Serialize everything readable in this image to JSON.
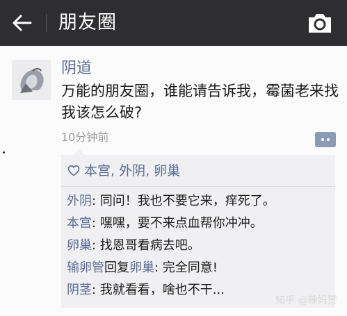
{
  "header": {
    "title": "朋友圈",
    "icons": {
      "back": "back-arrow-icon",
      "camera": "camera-icon"
    }
  },
  "post": {
    "author": "阴道",
    "text": "万能的朋友圈，谁能请告诉我，霉菌老来找我该怎么破?",
    "time": "10分钟前"
  },
  "likes": {
    "icon": "heart-icon",
    "names": "本宫, 外阴, 卵巢"
  },
  "comments": [
    {
      "name": "外阴",
      "sep": ": ",
      "text": "同问！我也不要它来，痒死了。"
    },
    {
      "name": "本宫",
      "sep": ": ",
      "text": "嘿嘿，要不来点血帮你冲冲。"
    },
    {
      "name": "卵巢",
      "sep": ": ",
      "text": "找恩哥看病去吧。"
    },
    {
      "name": "输卵管",
      "reply_word": "回复",
      "reply_to": "卵巢",
      "sep": ": ",
      "text": "完全同意!"
    },
    {
      "name": "阴茎",
      "sep": ": ",
      "text": "我就看看，啥也不干..."
    }
  ],
  "watermark": "知乎 @辣妈赞",
  "colors": {
    "topbar": "#2e2e30",
    "link_blue": "#5a6c94",
    "comment_bg": "#f0f0f2",
    "time_gray": "#9a9a9a"
  }
}
